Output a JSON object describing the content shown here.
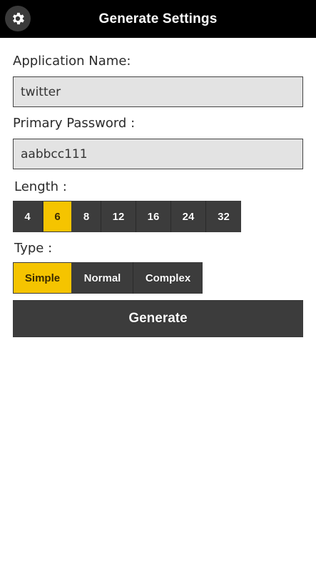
{
  "header": {
    "title": "Generate Settings",
    "settings_icon": "gear-icon"
  },
  "form": {
    "app_name_label": "Application Name:",
    "app_name_value": "twitter",
    "password_label": "Primary Password :",
    "password_value": "aabbcc111",
    "length_label": "Length :",
    "length_options": [
      "4",
      "6",
      "8",
      "12",
      "16",
      "24",
      "32"
    ],
    "length_selected": "6",
    "type_label": "Type :",
    "type_options": [
      "Simple",
      "Normal",
      "Complex"
    ],
    "type_selected": "Simple",
    "generate_label": "Generate"
  },
  "colors": {
    "accent": "#f5c400",
    "button": "#3c3c3c",
    "titlebar": "#000000",
    "field_bg": "#e3e3e3"
  }
}
